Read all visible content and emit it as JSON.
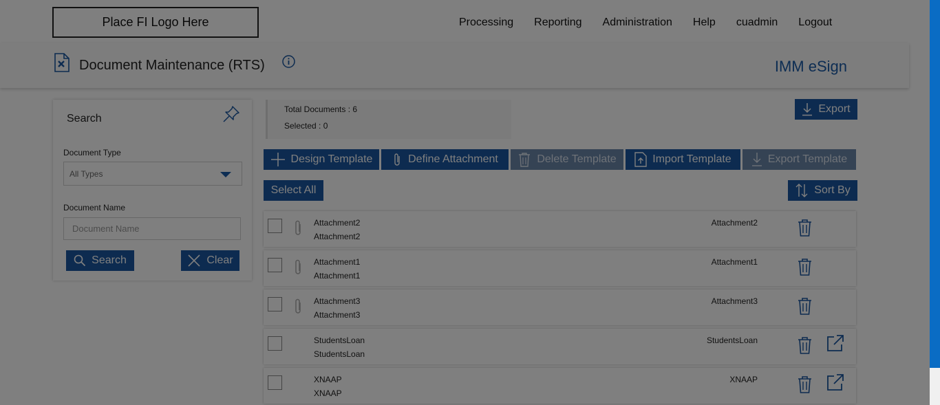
{
  "logo": {
    "text": "Place FI Logo Here"
  },
  "nav": {
    "items": [
      "Processing",
      "Reporting",
      "Administration",
      "Help",
      "cuadmin",
      "Logout"
    ]
  },
  "header": {
    "title": "Document Maintenance (RTS)",
    "product": "IMM eSign"
  },
  "search": {
    "title": "Search",
    "doc_type_label": "Document Type",
    "doc_type_value": "All Types",
    "doc_name_label": "Document Name",
    "doc_name_placeholder": "Document Name",
    "search_button": "Search",
    "clear_button": "Clear"
  },
  "summary": {
    "total_label": "Total Documents : 6",
    "selected_label": "Selected : 0"
  },
  "toolbar": {
    "export": "Export",
    "design_template": "Design Template",
    "define_attachment": "Define Attachment",
    "delete_template": "Delete Template",
    "import_template": "Import Template",
    "export_template": "Export Template",
    "select_all": "Select All",
    "sort_by": "Sort By"
  },
  "documents": [
    {
      "name": "Attachment2",
      "subname": "Attachment2",
      "type": "Attachment2",
      "attachment": true,
      "popout": false
    },
    {
      "name": "Attachment1",
      "subname": "Attachment1",
      "type": "Attachment1",
      "attachment": true,
      "popout": false
    },
    {
      "name": "Attachment3",
      "subname": "Attachment3",
      "type": "Attachment3",
      "attachment": true,
      "popout": false
    },
    {
      "name": "StudentsLoan",
      "subname": "StudentsLoan",
      "type": "StudentsLoan",
      "attachment": false,
      "popout": true
    },
    {
      "name": "XNAAP",
      "subname": "XNAAP",
      "type": "XNAAP",
      "attachment": false,
      "popout": true
    }
  ],
  "colors": {
    "primary": "#1a57a0",
    "scrollbar": "#0a6cc4",
    "overlay": "rgba(0,0,0,0.50)"
  }
}
